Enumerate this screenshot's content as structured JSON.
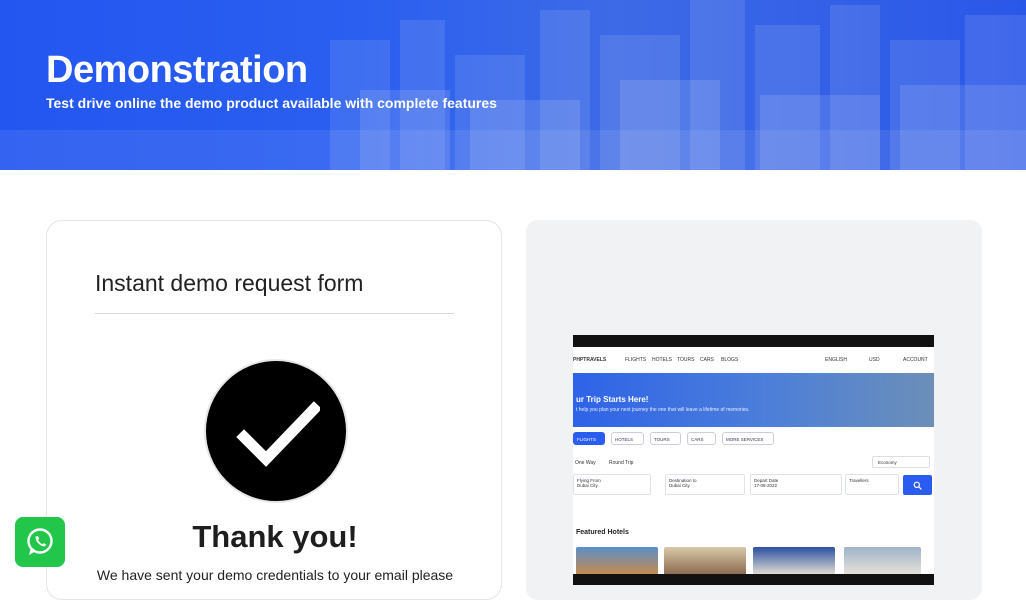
{
  "hero": {
    "title": "Demonstration",
    "subtitle": "Test drive online the demo product available with complete features"
  },
  "form_card": {
    "title": "Instant demo request form",
    "thank_you": "Thank you!",
    "message": "We have sent your demo credentials to your email please"
  },
  "preview": {
    "nav": {
      "brand": "PHPTRAVELS",
      "links": [
        "FLIGHTS",
        "HOTELS",
        "TOURS",
        "CARS",
        "BLOGS"
      ],
      "language": "ENGLISH",
      "currency": "USD",
      "account": "ACCOUNT"
    },
    "banner": {
      "headline": "ur Trip Starts Here!",
      "tagline": "t help you plan your next journey    the one that will leave a lifetime of memories."
    },
    "tabs": [
      "FLIGHTS",
      "HOTELS",
      "TOURS",
      "CARS",
      "MORE SERVICES"
    ],
    "trip_types": [
      "One Way",
      "Round Trip"
    ],
    "cabin_class": "Economy",
    "search": {
      "from_label": "Flying From",
      "from_value": "Dubai City",
      "to_label": "Destination to",
      "to_value": "Dubai City",
      "date_label": "Depart Date",
      "date_value": "17-08-2022",
      "travellers": "Travellers"
    },
    "featured_heading": "Featured Hotels"
  },
  "colors": {
    "hero_blue": "#2356f0",
    "whatsapp_green": "#22c64a",
    "preview_accent": "#2a5cf0"
  },
  "icons": [
    "checkmark-icon",
    "whatsapp-icon",
    "search-icon"
  ]
}
